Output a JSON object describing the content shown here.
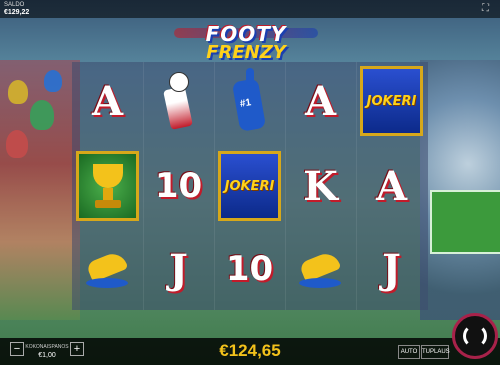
{
  "header": {
    "balance_label": "SALDO",
    "balance_value": "€129,22"
  },
  "logo": {
    "line1": "FOOTY",
    "line2": "FRENZY"
  },
  "reels": {
    "columns": [
      {
        "symbols": [
          "A",
          "trophy",
          "boot"
        ]
      },
      {
        "symbols": [
          "scarf",
          "10",
          "J"
        ]
      },
      {
        "symbols": [
          "foam-finger",
          "JOKERI",
          "10"
        ]
      },
      {
        "symbols": [
          "A",
          "K",
          "boot"
        ]
      },
      {
        "symbols": [
          "JOKERI",
          "A",
          "J"
        ]
      }
    ],
    "jokeri_label": "JOKERI",
    "foam_finger_number": "#1"
  },
  "footer": {
    "stake_label": "KOKONAISPANOS",
    "stake_value": "€1,00",
    "minus_label": "−",
    "plus_label": "+",
    "win_amount": "€124,65",
    "auto_label": "AUTO",
    "double_label": "TUPLAUS"
  },
  "colors": {
    "accent_gold": "#f3c21b",
    "spin_ring": "#a8224a",
    "joker_blue": "#1f5ac9"
  }
}
